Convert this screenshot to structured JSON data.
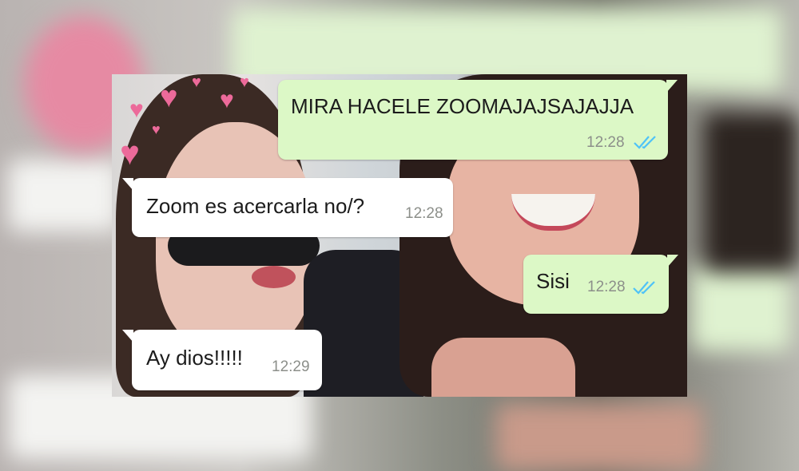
{
  "chat": {
    "messages": [
      {
        "direction": "out",
        "text": "MIRA HACELE ZOOMAJAJSAJAJJA",
        "time": "12:28",
        "status": "read"
      },
      {
        "direction": "in",
        "text": "Zoom es acercarla no/?",
        "time": "12:28"
      },
      {
        "direction": "out",
        "text": "Sisi",
        "time": "12:28",
        "status": "read"
      },
      {
        "direction": "in",
        "text": "Ay dios!!!!!",
        "time": "12:29"
      }
    ]
  },
  "colors": {
    "outgoing_bubble": "#dcf8c6",
    "incoming_bubble": "#ffffff",
    "read_ticks": "#4fc3f7",
    "timestamp": "#8c8f8a"
  },
  "icons": {
    "read_status": "double-check-icon",
    "sticker": "heart-icon"
  }
}
